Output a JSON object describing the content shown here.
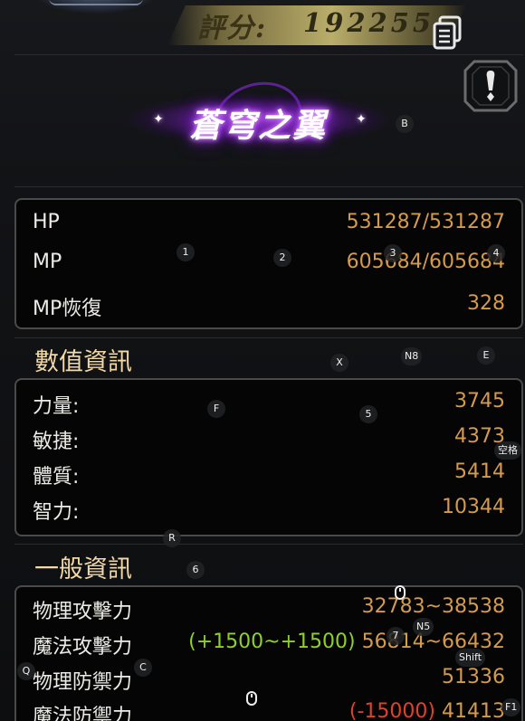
{
  "header": {
    "score_label": "評分:",
    "score_value": "192255"
  },
  "title": {
    "text": "蒼穹之翼"
  },
  "base_stats": [
    {
      "label": "HP",
      "value": "531287/531287"
    },
    {
      "label": "MP",
      "value": "605684/605684"
    },
    {
      "label": "MP恢復",
      "value": "328"
    }
  ],
  "numeric_info": {
    "heading": "數值資訊",
    "rows": [
      {
        "label": "力量:",
        "value": "3745"
      },
      {
        "label": "敏捷:",
        "value": "4373"
      },
      {
        "label": "體質:",
        "value": "5414"
      },
      {
        "label": "智力:",
        "value": "10344"
      }
    ]
  },
  "general_info": {
    "heading": "一般資訊",
    "rows": [
      {
        "label": "物理攻擊力",
        "bonus": "",
        "value": "32783~38538"
      },
      {
        "label": "魔法攻擊力",
        "bonus": "(+1500~+1500)",
        "value": "56814~66432"
      },
      {
        "label": "物理防禦力",
        "bonus": "",
        "value": "51336"
      },
      {
        "label": "魔法防禦力",
        "bonus": "(-15000)",
        "value": "41413"
      }
    ]
  },
  "key_hints": {
    "b": "B",
    "k1": "1",
    "k2": "2",
    "k3": "3",
    "k4": "4",
    "x": "X",
    "n8": "N8",
    "e": "E",
    "f": "F",
    "k5": "5",
    "space": "空格",
    "r": "R",
    "k6": "6",
    "k7": "7",
    "n5": "N5",
    "shift": "Shift",
    "q": "Q",
    "c": "C",
    "f1": "F1"
  },
  "colors": {
    "value": "#d49a4e",
    "bonus_positive": "#8ed12a",
    "bonus_negative": "#e0412a",
    "heading": "#f2d9a6"
  }
}
